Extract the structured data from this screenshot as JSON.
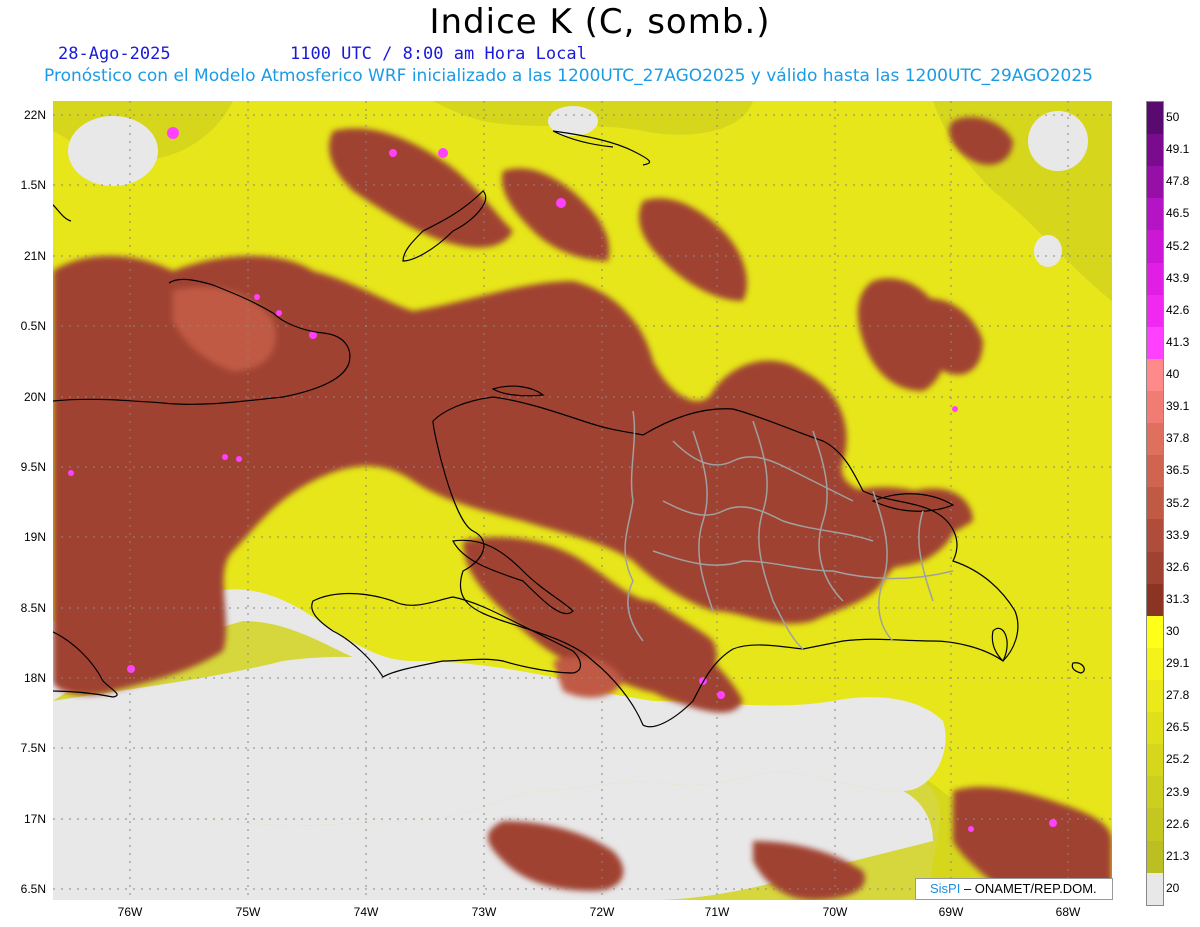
{
  "title": "Indice K (C, somb.)",
  "date": "28-Ago-2025",
  "time_label": "1100 UTC / 8:00 am Hora Local",
  "model_info": "Pronóstico con el Modelo Atmosferico WRF inicializado a las 1200UTC_27AGO2025 y válido hasta las  1200UTC_29AGO2025",
  "credit": {
    "logo": "SisPI",
    "org": "– ONAMET/REP.DOM."
  },
  "y_axis_labels": [
    "22N",
    "1.5N",
    "21N",
    "0.5N",
    "20N",
    "9.5N",
    "19N",
    "8.5N",
    "18N",
    "7.5N",
    "17N",
    "6.5N"
  ],
  "x_axis_labels": [
    "76W",
    "75W",
    "74W",
    "73W",
    "72W",
    "71W",
    "70W",
    "69W",
    "68W"
  ],
  "colorbar": {
    "labels": [
      "50",
      "49.1",
      "47.8",
      "46.5",
      "45.2",
      "43.9",
      "42.6",
      "41.3",
      "40",
      "39.1",
      "37.8",
      "36.5",
      "35.2",
      "33.9",
      "32.6",
      "31.3",
      "30",
      "29.1",
      "27.8",
      "26.5",
      "25.2",
      "23.9",
      "22.6",
      "21.3",
      "20"
    ],
    "colors": [
      "#5a0a6e",
      "#7a0a8e",
      "#9610a8",
      "#b414c4",
      "#cc18d6",
      "#e01ee6",
      "#f028f2",
      "#ff40ff",
      "#ff8a8a",
      "#f07c74",
      "#e0705e",
      "#d0644e",
      "#c05a44",
      "#b04c3a",
      "#a04232",
      "#8c3424",
      "#ffff1a",
      "#f5f21a",
      "#ebe91a",
      "#e0e01a",
      "#d6d71c",
      "#cccf1e",
      "#c4c720",
      "#bcbf22",
      "#e8e8e8"
    ]
  },
  "colors": {
    "subtitle_blue": "#1a1adb",
    "model_line_blue": "#1a9be6",
    "low_value_gray": "#e8e8e8"
  }
}
